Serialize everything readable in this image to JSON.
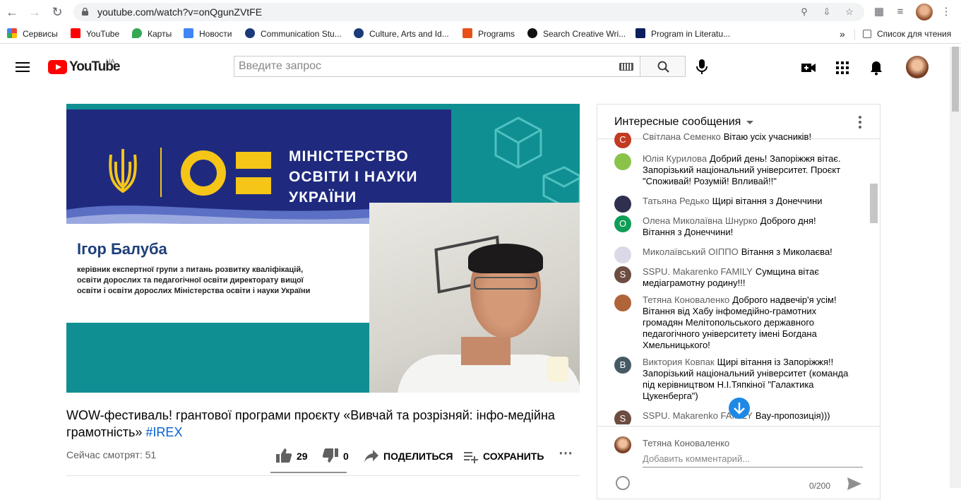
{
  "browser": {
    "url": "youtube.com/watch?v=onQgunZVtFE",
    "bookmarks": [
      {
        "label": "Сервисы",
        "color": "#4285f4"
      },
      {
        "label": "YouTube",
        "color": "#ff0000"
      },
      {
        "label": "Карты",
        "color": "#34a853"
      },
      {
        "label": "Новости",
        "color": "#4285f4"
      },
      {
        "label": "Communication Stu...",
        "color": "#1a3a7a"
      },
      {
        "label": "Culture, Arts and Id...",
        "color": "#1a3a7a"
      },
      {
        "label": "Programs",
        "color": "#e8501a"
      },
      {
        "label": "Search Creative Wri...",
        "color": "#111111"
      },
      {
        "label": "Program in Literatu...",
        "color": "#0b1f5c"
      }
    ],
    "overflow_label": "»",
    "reading_list": "Список для чтения"
  },
  "youtube": {
    "logo_text": "YouTube",
    "country_code": "UA",
    "search_placeholder": "Введите запрос"
  },
  "video": {
    "ministry_lines": [
      "МІНІСТЕРСТВО",
      "ОСВІТИ І НАУКИ",
      "УКРАЇНИ"
    ],
    "speaker_name": "Ігор Балуба",
    "speaker_role": "керівник експертної групи з питань розвитку кваліфікацій, освіти дорослих та педагогічної освіти директорату вищої освіти і освіти дорослих Міністерства освіти і науки України",
    "title": "WOW-фестиваль! грантової програми проєкту «Вивчай та розрізняй: інфо-медійна грамотність»",
    "hashtag": "#IREX",
    "viewers": "Сейчас смотрят: 51",
    "likes": "29",
    "dislikes": "0",
    "share_label": "ПОДЕЛИТЬСЯ",
    "save_label": "СОХРАНИТЬ"
  },
  "chat": {
    "title": "Интересные сообщения",
    "messages": [
      {
        "author": "Світлана Семенко",
        "text": "Вітаю усіх учасників!",
        "initial": "С",
        "color": "#c23b22"
      },
      {
        "author": "Юлія Курилова",
        "text": "Добрий день! Запоріжжя вітає. Запорізький національний університет. Проєкт \"Споживай! Розумій! Впливай!!\"",
        "initial": "",
        "color": "#8bc34a"
      },
      {
        "author": "Татьяна Редько",
        "text": "Щирі вітання з Донеччини",
        "initial": "",
        "color": "#2f2f4f"
      },
      {
        "author": "Олена Миколаївна Шнурко",
        "text": "Доброго дня! Вітання з Донеччини!",
        "initial": "О",
        "color": "#0f9d58"
      },
      {
        "author": "Миколаївський ОІППО",
        "text": "Вітання з Миколаєва!",
        "initial": "",
        "color": "#d9d9e8"
      },
      {
        "author": "SSPU. Makarenko FAMILY",
        "text": "Сумщина вітає медіаграмотну родину!!!",
        "initial": "S",
        "color": "#6d4c41"
      },
      {
        "author": "Тетяна Коноваленко",
        "text": "Доброго надвечір'я усім! Вітання від Хабу інфомедійно-грамотних громадян Мелітопольського державного педагогічного університету імені Богдана Хмельницького!",
        "initial": "",
        "color": "#b0643a"
      },
      {
        "author": "Виктория Ковпак",
        "text": "Щирі вітання із Запоріжжя!! Запорізький національний університет (команда під керівництвом Н.І.Тяпкіної \"Галактика Цукенберга\")",
        "initial": "В",
        "color": "#455a64"
      },
      {
        "author": "SSPU. Makarenko FAMILY",
        "text": "Вау-пропозиція)))",
        "initial": "S",
        "color": "#6d4c41"
      }
    ],
    "current_user": "Тетяна Коноваленко",
    "comment_placeholder": "Добавить комментарий...",
    "char_counter": "0/200"
  }
}
